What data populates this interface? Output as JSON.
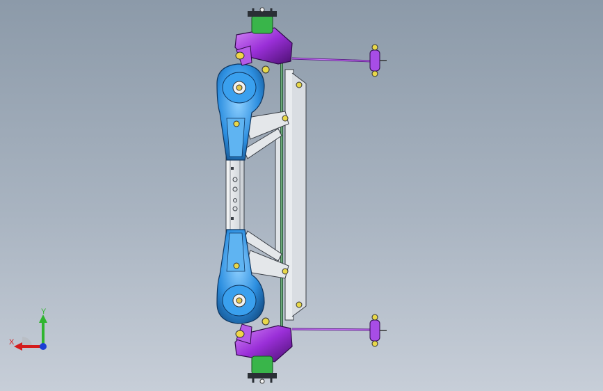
{
  "viewport": {
    "background_top": "#8c9aa9",
    "background_bottom": "#c7ced8"
  },
  "colors": {
    "arm": "#2d8fe0",
    "arm_light": "#5fb4f2",
    "knuckle": "#9a2fd8",
    "knuckle_light": "#c36cf2",
    "hub": "#39b54a",
    "frame": "#e4e7ea",
    "frame_edge": "#3a3f46",
    "bushing": "#e8d84a"
  },
  "triad": {
    "x_label": "X",
    "y_label": "Y",
    "x_color": "#d41c1c",
    "y_color": "#2fb52f",
    "z_color": "#1c3fd4"
  }
}
